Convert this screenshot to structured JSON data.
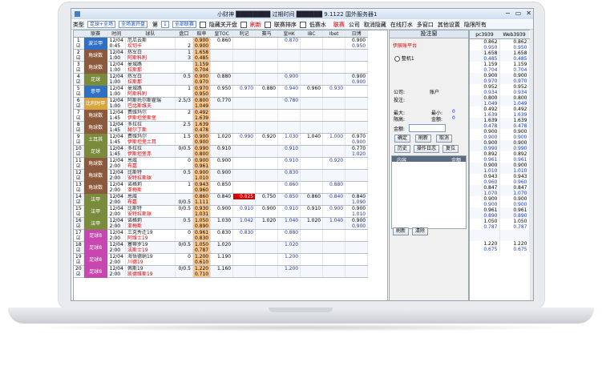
{
  "window": {
    "title": "小财神 ████████ 过期时间 ██████ 9.1122 国外服务器1",
    "min": "−",
    "restore": "▭",
    "close": "✕"
  },
  "toolbar": {
    "type_label": "类型",
    "type_value": "足球+全场",
    "sort_value": "全场滚开盘",
    "page_label": "第",
    "page_value": "1",
    "league_value": "全部联赛",
    "hide_closed": "隐藏关开盘",
    "refresh": "刷新",
    "odds_sort": "联赛排序",
    "low_water": "低赛水",
    "links": [
      "联赛",
      "公司",
      "取消隐藏",
      "在线打水",
      "多窗口",
      "其他设置",
      "隐限所有"
    ]
  },
  "headers": [
    "",
    "联赛",
    "时间",
    "球队",
    "盘口",
    "赔率",
    "皇TOC",
    "利记",
    "赛马",
    "皇HK",
    "IBC",
    "Ibet",
    "日博"
  ],
  "colors": {
    "team_blue": "#2f6fc4",
    "team_brown": "#8b5a3c",
    "team_olive": "#7a8b3a",
    "team_violet": "#7a3f8f",
    "team_pink": "#c846b0",
    "orange": "#f7c68d",
    "red_cell": "#d80000",
    "blue_text": "#1a3ad0",
    "red_text": "#d40000"
  },
  "rows": [
    {
      "no": "1",
      "team": "波兰甲",
      "color": "#2f6fc4",
      "time1": "12/04",
      "time2": "0:45",
      "home": "厄瓜云斯",
      "away": "坎切卡",
      "hc": "",
      "hc2": "2",
      "odds": "0.900",
      "odds2": "0.900",
      "c1": "0.860",
      "c2": "",
      "c3": "",
      "c4": "0.870",
      "c5": "",
      "c6": "",
      "c7": "0.900",
      "c7b": "0.950"
    },
    {
      "no": "2",
      "team": "角球数",
      "color": "#8b5a3c",
      "time1": "12/04",
      "time2": "1:00",
      "home": "热军白",
      "away": "阿斯科利",
      "hc": "1",
      "hc2": "3",
      "odds": "1.658",
      "odds2": "0.485",
      "c1": "",
      "c2": "",
      "c3": "",
      "c4": "",
      "c5": "",
      "c6": "",
      "c7": "",
      "c7b": ""
    },
    {
      "no": "3",
      "team": "角球数",
      "color": "#8b5a3c",
      "time1": "12/04",
      "time2": "1:00",
      "home": "曼城路",
      "away": "拉斯那",
      "hc": "",
      "hc2": "",
      "odds": "1.159",
      "odds2": "0.704",
      "c1": "",
      "c2": "",
      "c3": "",
      "c4": "",
      "c5": "",
      "c6": "",
      "c7": "",
      "c7b": ""
    },
    {
      "no": "4",
      "team": "足球",
      "color": "#7a8b3a",
      "time1": "12/04",
      "time2": "1:00",
      "home": "热军白",
      "away": "拉斯那",
      "hc": "0.5",
      "hc2": "",
      "odds": "0.900",
      "odds2": "0.970",
      "c1": "0.880",
      "c2": "",
      "c3": "",
      "c4": "0.900",
      "c5": "",
      "c6": "",
      "c7": "0.900",
      "c7b": "0.900"
    },
    {
      "no": "5",
      "team": "意甲",
      "color": "#2f6fc4",
      "time1": "12/04",
      "time2": "1:00",
      "home": "曼城路",
      "away": "阿斯科利",
      "hc": "1",
      "hc2": "",
      "odds": "0.970",
      "odds2": "0.950",
      "c1": "0.950",
      "c2": "0.970",
      "c3": "0.880",
      "c4": "0.940",
      "c5": "0.960",
      "c6": "0.930",
      "c7": "",
      "c7b": ""
    },
    {
      "no": "6",
      "team": "比利时甲",
      "color": "#d9a53a",
      "time1": "12/04",
      "time2": "1:00",
      "home": "阿斯托尔斯霍瑞",
      "away": "巴比斯维夫",
      "hc": "2.5/3",
      "hc2": "",
      "odds": "0.800",
      "odds2": "1.049",
      "c1": "0.770",
      "c2": "",
      "c3": "",
      "c4": "0.780",
      "c5": "",
      "c6": "",
      "c7": "",
      "c7b": ""
    },
    {
      "no": "7",
      "team": "角球数",
      "color": "#8b5a3c",
      "time1": "12/04",
      "time2": "1:45",
      "home": "费维玛尔",
      "away": "伊斯坦堡斯堡",
      "hc": "2",
      "hc2": "",
      "odds": "0.492",
      "odds2": "1.639",
      "c1": "",
      "c2": "",
      "c3": "",
      "c4": "",
      "c5": "",
      "c6": "",
      "c7": "",
      "c7b": ""
    },
    {
      "no": "8",
      "team": "角球数",
      "color": "#8b5a3c",
      "time1": "12/04",
      "time2": "1:45",
      "home": "多拉拉",
      "away": "赫尔丁斯",
      "hc": "2.5",
      "hc2": "",
      "odds": "1.639",
      "odds2": "0.478",
      "c1": "",
      "c2": "",
      "c3": "",
      "c4": "",
      "c5": "",
      "c6": "",
      "c7": "",
      "c7b": ""
    },
    {
      "no": "9",
      "team": "土耳其",
      "color": "#7a8b3a",
      "time1": "12/04",
      "time2": "1:45",
      "home": "费维玛尔",
      "away": "伊斯坦堡土耳",
      "hc": "1.5",
      "hc2": "",
      "odds": "0.900",
      "odds2": "0.900",
      "c1": "1.020",
      "c2": "0.990",
      "c3": "0.920",
      "c4": "1.030",
      "c5": "1.040",
      "c6": "1.000",
      "c7": "0.970",
      "c7b": "0.900"
    },
    {
      "no": "10",
      "team": "足球",
      "color": "#7a8b3a",
      "time1": "12/04",
      "time2": "1:45",
      "home": "多拉拉",
      "away": "伊斯坦堡赤",
      "hc": "0/0.5",
      "hc2": "",
      "odds": "0.990",
      "odds2": "0.800",
      "c1": "0.910",
      "c2": "",
      "c3": "",
      "c4": "0.910",
      "c5": "",
      "c6": "",
      "c7": "0.770",
      "c7b": "1.020"
    },
    {
      "no": "11",
      "team": "角球数",
      "color": "#8b5a3c",
      "time1": "12/04",
      "time2": "2:00",
      "home": "恩威",
      "away": "布嘉",
      "hc": "0",
      "hc2": "",
      "odds": "0.900",
      "odds2": "0.961",
      "c1": "0.900",
      "c2": "",
      "c3": "",
      "c4": "0.910",
      "c5": "",
      "c6": "0.920",
      "c7": "",
      "c7b": ""
    },
    {
      "no": "12",
      "team": "角球数",
      "color": "#8b5a3c",
      "time1": "12/04",
      "time2": "2:00",
      "home": "比斯特",
      "away": "安特拉斯球",
      "hc": "0.5",
      "hc2": "",
      "odds": "0.900",
      "odds2": "1.010",
      "c1": "0.900",
      "c2": "",
      "c3": "",
      "c4": "0.830",
      "c5": "",
      "c6": "",
      "c7": "",
      "c7b": ""
    },
    {
      "no": "13",
      "team": "角球数",
      "color": "#8b5a3c",
      "time1": "12/04",
      "time2": "2:00",
      "home": "诺格莉",
      "away": "亚梅斯",
      "hc": "1",
      "hc2": "",
      "odds": "0.943",
      "odds2": "0.960",
      "c1": "0.850",
      "c2": "",
      "c3": "",
      "c4": "0.860",
      "c5": "",
      "c6": "0.880",
      "c7": "",
      "c7b": ""
    },
    {
      "no": "14",
      "team": "法甲",
      "color": "#7a8b3a",
      "time1": "12/04",
      "time2": "2:00",
      "home": "恩威",
      "away": "布嘉",
      "hc": "",
      "hc2": "0/0.5",
      "odds": "0.860",
      "odds2": "1.111",
      "c1": "0.840",
      "c2": "0.825",
      "c3": "0.750",
      "c4": "0.850",
      "c5": "0.860",
      "c6": "0.840",
      "c7": "0.840",
      "c7b": "1.090"
    },
    {
      "no": "15",
      "team": "法甲",
      "color": "#7a8b3a",
      "time1": "12/04",
      "time2": "2:00",
      "home": "比斯特",
      "away": "安特拉斯球",
      "hc": "0/0.5",
      "hc2": "",
      "odds": "0.930",
      "odds2": "1.031",
      "c1": "0.900",
      "c2": "0.910",
      "c3": "0.900",
      "c4": "0.910",
      "c5": "0.910",
      "c6": "0.900",
      "c7": "0.900",
      "c7b": "1.010"
    },
    {
      "no": "16",
      "team": "法甲",
      "color": "#7a8b3a",
      "time1": "12/04",
      "time2": "2:00",
      "home": "诺格莉",
      "away": "亚梅斯",
      "hc": "0.5",
      "hc2": "",
      "odds": "1.050",
      "odds2": "0.890",
      "c1": "1.030",
      "c2": "1.042",
      "c3": "1.020",
      "c4": "1.040",
      "c5": "1.020",
      "c6": "1.040",
      "c7": "0.900",
      "c7b": "0.900"
    },
    {
      "no": "17",
      "team": "足球8",
      "color": "#c846b0",
      "time1": "12/04",
      "time2": "2:00",
      "home": "三克秀迁19",
      "away": "阿维士19",
      "hc": "0",
      "hc2": "",
      "odds": "0.961",
      "odds2": "0.830",
      "c1": "0.830",
      "c2": "0.830",
      "c3": "",
      "c4": "0.880",
      "c5": "",
      "c6": "",
      "c7": "",
      "c7b": ""
    },
    {
      "no": "18",
      "team": "足球8",
      "color": "#c846b0",
      "time1": "12/04",
      "time2": "2:00",
      "home": "塞蒂罗19",
      "away": "法斯士19",
      "hc": "0/0.5",
      "hc2": "",
      "odds": "1.050",
      "odds2": "0.787",
      "c1": "1.020",
      "c2": "",
      "c3": "",
      "c4": "1.020",
      "c5": "",
      "c6": "",
      "c7": "",
      "c7b": ""
    },
    {
      "no": "19",
      "team": "足球8",
      "color": "#c846b0",
      "time1": "12/04",
      "time2": "2:00",
      "home": "海悟德纳19",
      "away": "川德19",
      "hc": "0",
      "hc2": "",
      "odds": "1.200",
      "odds2": "0.610",
      "c1": "1.190",
      "c2": "",
      "c3": "",
      "c4": "1.200",
      "c5": "",
      "c6": "",
      "c7": "",
      "c7b": ""
    },
    {
      "no": "20",
      "team": "足球8",
      "color": "#c846b0",
      "time1": "12/04",
      "time2": "2:00",
      "home": "佩斯19",
      "away": "凯德维斯19",
      "hc": "0/0.5",
      "hc2": "",
      "odds": "1.220",
      "odds2": "0.710",
      "c1": "1.160",
      "c2": "",
      "c3": "",
      "c4": "1.200",
      "c5": "",
      "c6": "",
      "c7": "",
      "c7b": ""
    }
  ],
  "panel": {
    "title": "投注窗",
    "section": "伊辰账平台",
    "radio_label": "整机1",
    "company_label": "公司:",
    "account_label": "账户",
    "odds_label": "投注:",
    "max_label": "最大:",
    "min_label": "最小:",
    "min_val": "0",
    "limit_label": "限高:",
    "amount_label": "金额:",
    "amount_val": "0",
    "balance_label": "金额:",
    "buttons": [
      "确定",
      "刷新",
      "取消"
    ],
    "buttons2": [
      "历史",
      "操作日志",
      "复位"
    ],
    "list_header": "内容",
    "list_header2": "金额",
    "footer": [
      "刷新",
      "清除"
    ]
  },
  "far": {
    "headers": [
      "pc3939",
      "Web3939"
    ],
    "rows": [
      [
        "0.862",
        "0.862"
      ],
      [
        "0.950",
        "0.950"
      ],
      [
        "1.658",
        "1.658"
      ],
      [
        "0.485",
        "0.485"
      ],
      [
        "1.159",
        "1.159"
      ],
      [
        "0.704",
        "0.704"
      ],
      [
        "0.900",
        "0.900"
      ],
      [
        "0.970",
        "0.970"
      ],
      [
        "0.952",
        "0.952"
      ],
      [
        "0.934",
        "0.934"
      ],
      [
        "0.800",
        "0.800"
      ],
      [
        "1.049",
        "1.049"
      ],
      [
        "0.492",
        "0.492"
      ],
      [
        "1.639",
        "1.639"
      ],
      [
        "1.639",
        "1.639"
      ],
      [
        "0.478",
        "0.478"
      ],
      [
        "0.900",
        "0.900"
      ],
      [
        "0.900",
        "0.900"
      ],
      [
        "0.900",
        "0.900"
      ],
      [
        "0.990",
        "0.990"
      ],
      [
        "0.892",
        "0.892"
      ],
      [
        "0.961",
        "0.961"
      ],
      [
        "0.900",
        "0.900"
      ],
      [
        "1.010",
        "1.010"
      ],
      [
        "0.943",
        "0.943"
      ],
      [
        "0.960",
        "0.960"
      ],
      [
        "0.847",
        "0.847"
      ],
      [
        "1.070",
        "1.070"
      ],
      [
        "0.900",
        "0.900"
      ],
      [
        "0.900",
        "0.900"
      ],
      [
        "0.961",
        "0.961"
      ],
      [
        "0.890",
        "0.890"
      ],
      [
        "1.050",
        "1.050"
      ],
      [
        "0.787",
        "0.787"
      ],
      [
        "",
        ""
      ],
      [
        "",
        ""
      ],
      [
        "1.220",
        "1.220"
      ],
      [
        "0.675",
        "0.675"
      ]
    ]
  }
}
